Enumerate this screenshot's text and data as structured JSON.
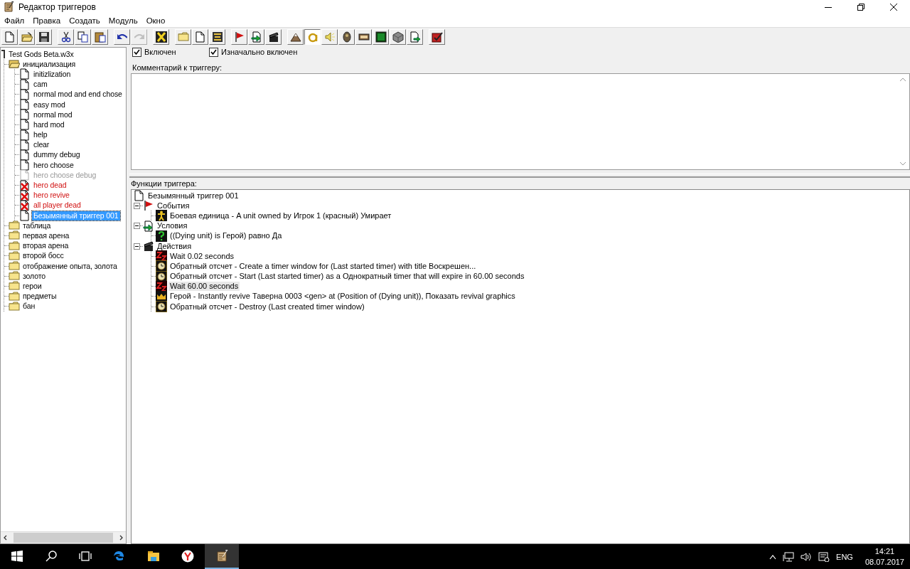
{
  "window": {
    "title": "Редактор триггеров"
  },
  "menu": [
    "Файл",
    "Правка",
    "Создать",
    "Модуль",
    "Окно"
  ],
  "toolbar": {
    "groups": [
      [
        {
          "kind": "new",
          "pressed": false,
          "disabled": false
        },
        {
          "kind": "open",
          "pressed": false,
          "disabled": false
        },
        {
          "kind": "save",
          "pressed": false,
          "disabled": false
        }
      ],
      [
        {
          "kind": "cut",
          "pressed": false,
          "disabled": false
        },
        {
          "kind": "copy",
          "pressed": false,
          "disabled": false
        },
        {
          "kind": "paste",
          "pressed": false,
          "disabled": false
        }
      ],
      [
        {
          "kind": "undo",
          "pressed": false,
          "disabled": false
        },
        {
          "kind": "redo",
          "pressed": false,
          "disabled": true
        }
      ],
      [
        {
          "kind": "variables",
          "pressed": false,
          "disabled": false
        }
      ],
      [
        {
          "kind": "category",
          "pressed": false,
          "disabled": false
        },
        {
          "kind": "trigger",
          "pressed": false,
          "disabled": false
        },
        {
          "kind": "comment",
          "pressed": false,
          "disabled": false
        }
      ],
      [
        {
          "kind": "event",
          "pressed": false,
          "disabled": false
        },
        {
          "kind": "condition",
          "pressed": false,
          "disabled": false
        },
        {
          "kind": "action",
          "pressed": false,
          "disabled": false
        }
      ],
      [
        {
          "kind": "terrain",
          "pressed": false,
          "disabled": false
        },
        {
          "kind": "object",
          "pressed": true,
          "disabled": false
        },
        {
          "kind": "sound",
          "pressed": false,
          "disabled": false
        },
        {
          "kind": "ai",
          "pressed": false,
          "disabled": false
        },
        {
          "kind": "panel",
          "pressed": false,
          "disabled": false
        },
        {
          "kind": "board",
          "pressed": false,
          "disabled": false
        },
        {
          "kind": "cube",
          "pressed": false,
          "disabled": false
        },
        {
          "kind": "import",
          "pressed": false,
          "disabled": false
        }
      ],
      [
        {
          "kind": "test",
          "pressed": false,
          "disabled": false
        }
      ]
    ]
  },
  "trigger_tree": {
    "root": "Test Gods Beta.w3x",
    "items": [
      {
        "kind": "folder",
        "label": "инициализация",
        "expanded": true,
        "selected": false,
        "children": [
          {
            "kind": "trigger",
            "label": "initizlization",
            "disabled": false,
            "error": false,
            "selected": false
          },
          {
            "kind": "trigger",
            "label": "cam",
            "disabled": false,
            "error": false,
            "selected": false
          },
          {
            "kind": "trigger",
            "label": "normal mod and end chose",
            "disabled": false,
            "error": false,
            "selected": false
          },
          {
            "kind": "trigger",
            "label": "easy mod",
            "disabled": false,
            "error": false,
            "selected": false
          },
          {
            "kind": "trigger",
            "label": "normal mod",
            "disabled": false,
            "error": false,
            "selected": false
          },
          {
            "kind": "trigger",
            "label": "hard mod",
            "disabled": false,
            "error": false,
            "selected": false
          },
          {
            "kind": "trigger",
            "label": "help",
            "disabled": false,
            "error": false,
            "selected": false
          },
          {
            "kind": "trigger",
            "label": "clear",
            "disabled": false,
            "error": false,
            "selected": false
          },
          {
            "kind": "trigger",
            "label": "dummy debug",
            "disabled": false,
            "error": false,
            "selected": false
          },
          {
            "kind": "trigger",
            "label": "hero choose",
            "disabled": false,
            "error": false,
            "selected": false
          },
          {
            "kind": "trigger",
            "label": "hero choose debug",
            "disabled": true,
            "error": false,
            "selected": false
          },
          {
            "kind": "trigger",
            "label": "hero dead",
            "disabled": false,
            "error": true,
            "selected": false
          },
          {
            "kind": "trigger",
            "label": "hero revive",
            "disabled": false,
            "error": true,
            "selected": false
          },
          {
            "kind": "trigger",
            "label": "all player dead",
            "disabled": false,
            "error": true,
            "selected": false
          },
          {
            "kind": "trigger",
            "label": "Безымянный триггер 001",
            "disabled": false,
            "error": false,
            "selected": true
          }
        ]
      },
      {
        "kind": "folder",
        "label": "таблица",
        "selected": false
      },
      {
        "kind": "folder",
        "label": "первая арена",
        "selected": false
      },
      {
        "kind": "folder",
        "label": "вторая арена",
        "selected": false
      },
      {
        "kind": "folder",
        "label": "второй босс",
        "selected": false
      },
      {
        "kind": "folder",
        "label": "отображение опыта, золота",
        "selected": false
      },
      {
        "kind": "folder",
        "label": "золото",
        "selected": false
      },
      {
        "kind": "folder",
        "label": "герои",
        "selected": false
      },
      {
        "kind": "folder",
        "label": "предметы",
        "selected": false
      },
      {
        "kind": "folder",
        "label": "бан",
        "selected": false
      }
    ]
  },
  "trigger": {
    "enabled": {
      "label": "Включен",
      "checked": true
    },
    "initially_on": {
      "label": "Изначально включен",
      "checked": true
    },
    "comment_label": "Комментарий к триггеру:",
    "functions_label": "Функции триггера:"
  },
  "functions": {
    "root": "Безымянный триггер 001",
    "groups": [
      {
        "kind": "events",
        "label": "События",
        "expanded": true,
        "items": [
          {
            "kind": "unit",
            "label": "Боевая единица - A unit owned by Игрок 1 (красный) Умирает",
            "selected": false
          }
        ]
      },
      {
        "kind": "conditions",
        "label": "Условия",
        "expanded": true,
        "items": [
          {
            "kind": "question",
            "label": "((Dying unit) is Герой) равно Да",
            "selected": false
          }
        ]
      },
      {
        "kind": "actions",
        "label": "Действия",
        "expanded": true,
        "items": [
          {
            "kind": "wait",
            "label": "Wait 0.02 seconds",
            "selected": false
          },
          {
            "kind": "timer",
            "label": "Обратный отсчет - Create a timer window for (Last started timer) with title Воскрешен...",
            "selected": false
          },
          {
            "kind": "timer",
            "label": "Обратный отсчет - Start (Last started timer) as a Однократный timer that will expire in 60.00 seconds",
            "selected": false
          },
          {
            "kind": "wait",
            "label": "Wait 60.00 seconds",
            "selected": true
          },
          {
            "kind": "hero",
            "label": "Герой - Instantly revive Таверна 0003 <gen> at (Position of (Dying unit)), Показать revival graphics",
            "selected": false
          },
          {
            "kind": "timer",
            "label": "Обратный отсчет - Destroy (Last created timer window)",
            "selected": false
          }
        ]
      }
    ]
  },
  "taskbar": {
    "apps": [
      {
        "kind": "search",
        "active": false
      },
      {
        "kind": "taskview",
        "active": false
      },
      {
        "kind": "edge",
        "active": false
      },
      {
        "kind": "explorer",
        "active": false
      },
      {
        "kind": "yandex",
        "active": false
      },
      {
        "kind": "editor",
        "active": true
      }
    ],
    "language": "ENG",
    "time": "14:21",
    "date": "08.07.2017"
  }
}
